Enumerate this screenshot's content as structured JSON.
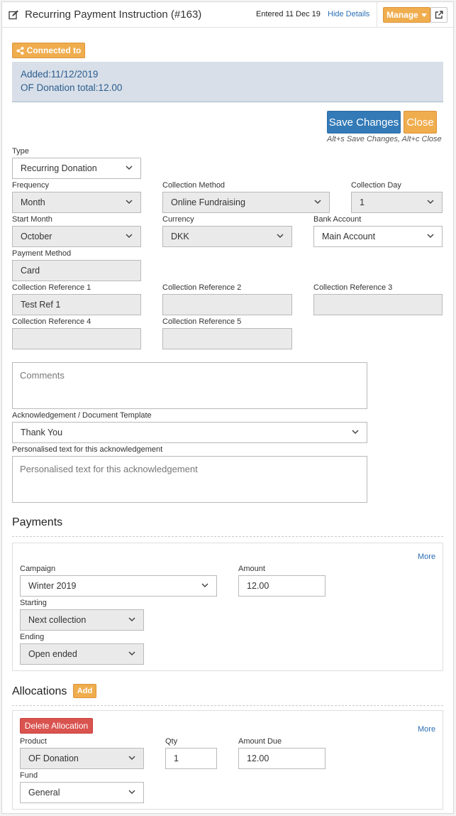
{
  "header": {
    "title": "Recurring Payment Instruction (#163)",
    "entered": "Entered 11 Dec 19",
    "hide_details": "Hide Details",
    "manage": "Manage"
  },
  "connected": {
    "label": "Connected to"
  },
  "info": {
    "added": "Added:11/12/2019",
    "total": "OF Donation total:12.00"
  },
  "actions": {
    "save": "Save Changes",
    "close": "Close",
    "hint": "Alt+s Save Changes, Alt+c Close"
  },
  "form": {
    "type": {
      "label": "Type",
      "value": "Recurring Donation"
    },
    "frequency": {
      "label": "Frequency",
      "value": "Month"
    },
    "collection_method": {
      "label": "Collection Method",
      "value": "Online Fundraising"
    },
    "collection_day": {
      "label": "Collection Day",
      "value": "1"
    },
    "start_month": {
      "label": "Start Month",
      "value": "October"
    },
    "currency": {
      "label": "Currency",
      "value": "DKK"
    },
    "bank_account": {
      "label": "Bank Account",
      "value": "Main Account"
    },
    "payment_method": {
      "label": "Payment Method",
      "value": "Card"
    },
    "ref1": {
      "label": "Collection Reference 1",
      "value": "Test Ref 1"
    },
    "ref2": {
      "label": "Collection Reference 2",
      "value": ""
    },
    "ref3": {
      "label": "Collection Reference 3",
      "value": ""
    },
    "ref4": {
      "label": "Collection Reference 4",
      "value": ""
    },
    "ref5": {
      "label": "Collection Reference 5",
      "value": ""
    },
    "comments": {
      "placeholder": "Comments"
    },
    "template": {
      "label": "Acknowledgement / Document Template",
      "value": "Thank You"
    },
    "personalised": {
      "label": "Personalised text for this acknowledgement",
      "placeholder": "Personalised text for this acknowledgement"
    }
  },
  "payments": {
    "title": "Payments",
    "more": "More",
    "campaign": {
      "label": "Campaign",
      "value": "Winter 2019"
    },
    "amount": {
      "label": "Amount",
      "value": "12.00"
    },
    "starting": {
      "label": "Starting",
      "value": "Next collection"
    },
    "ending": {
      "label": "Ending",
      "value": "Open ended"
    }
  },
  "allocations": {
    "title": "Allocations",
    "add": "Add",
    "delete": "Delete Allocation",
    "more": "More",
    "product": {
      "label": "Product",
      "value": "OF Donation"
    },
    "qty": {
      "label": "Qty",
      "value": "1"
    },
    "amount_due": {
      "label": "Amount Due",
      "value": "12.00"
    },
    "fund": {
      "label": "Fund",
      "value": "General"
    }
  },
  "colors": {
    "primary": "#337ab7",
    "warning": "#f0ad4e",
    "danger": "#d9534f",
    "info_bg": "#d8dfe8"
  },
  "icons": {
    "title": "edit-icon",
    "connected": "share-icon",
    "external": "external-link-icon",
    "select": "chevron-down-icon"
  }
}
